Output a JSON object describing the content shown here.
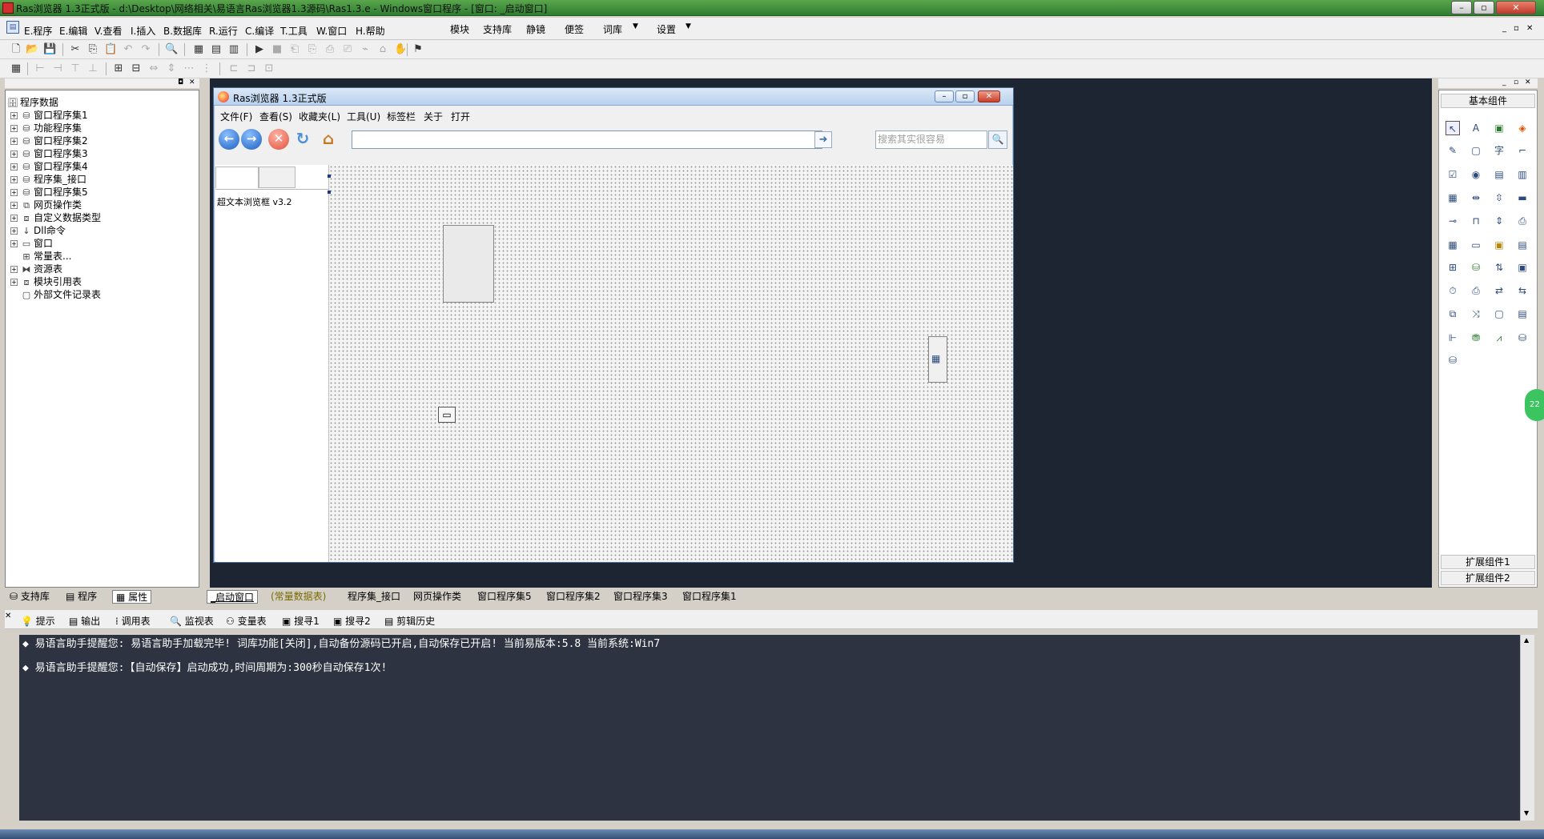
{
  "titlebar": {
    "text": "Ras浏览器 1.3正式版 - d:\\Desktop\\网络相关\\易语言Ras浏览器1.3源码\\Ras1.3.e - Windows窗口程序 - [窗口: _启动窗口]"
  },
  "menu": {
    "items": [
      "E.程序",
      "E.编辑",
      "V.查看",
      "I.插入",
      "B.数据库",
      "R.运行",
      "C.编译",
      "T.工具",
      "W.窗口",
      "H.帮助"
    ],
    "extra": [
      "模块",
      "支持库",
      "静镜",
      "便签",
      "词库",
      "设置"
    ]
  },
  "tree": {
    "root": "程序数据",
    "items": [
      "窗口程序集1",
      "功能程序集",
      "窗口程序集2",
      "窗口程序集3",
      "窗口程序集4",
      "程序集_接口",
      "窗口程序集5",
      "网页操作类",
      "自定义数据类型",
      "Dll命令",
      "窗口",
      "常量表...",
      "资源表",
      "模块引用表",
      "外部文件记录表"
    ]
  },
  "left_tabs": [
    "支持库",
    "程序",
    "属性"
  ],
  "form": {
    "title": "Ras浏览器 1.3正式版",
    "menu": [
      "文件(F)",
      "查看(S)",
      "收藏夹(L)",
      "工具(U)",
      "标签栏",
      "关于",
      "打开"
    ],
    "search_placeholder": "搜索其实很容易",
    "side_text": "超文本浏览框 v3.2"
  },
  "right_panel": {
    "title": "基本组件",
    "ext1": "扩展组件1",
    "ext2": "扩展组件2"
  },
  "bottom_tabs": [
    "_启动窗口",
    "(常量数据表)",
    "程序集_接口",
    "网页操作类",
    "窗口程序集5",
    "窗口程序集2",
    "窗口程序集3",
    "窗口程序集1"
  ],
  "output_tabs": [
    "提示",
    "输出",
    "调用表",
    "监视表",
    "变量表",
    "搜寻1",
    "搜寻2",
    "剪辑历史"
  ],
  "output": {
    "lines": [
      "易语言助手提醒您:  易语言助手加载完毕! 词库功能[关闭],自动备份源码已开启,自动保存已开启! 当前易版本:5.8  当前系统:Win7",
      "易语言助手提醒您:【自动保存】启动成功,时间周期为:300秒自动保存1次!"
    ]
  },
  "badge": "22"
}
